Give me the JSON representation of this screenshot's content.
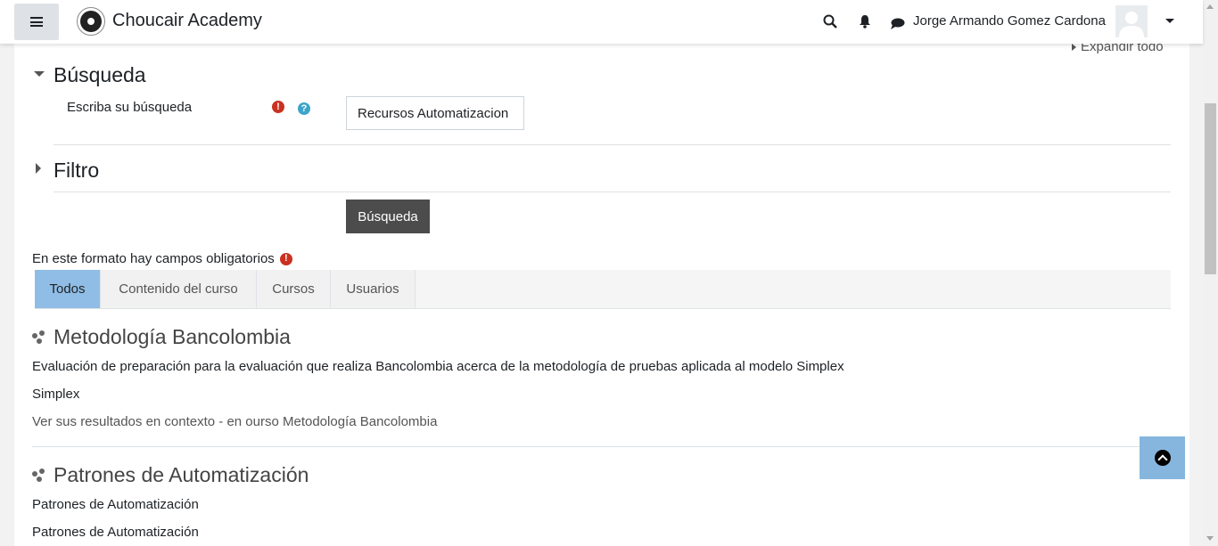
{
  "header": {
    "site_name": "Choucair Academy",
    "user_name": "Jorge Armando Gomez Cardona"
  },
  "form": {
    "expand_all": "Expandir todo",
    "search_section": "Búsqueda",
    "search_label": "Escriba su búsqueda",
    "search_value": "Recursos Automatizacion",
    "filter_section": "Filtro",
    "submit_label": "Búsqueda",
    "required_note": "En este formato hay campos obligatorios"
  },
  "tabs": [
    "Todos",
    "Contenido del curso",
    "Cursos",
    "Usuarios"
  ],
  "results": [
    {
      "title": "Metodología Bancolombia",
      "description": "Evaluación de preparación para la evaluación que realiza Bancolombia acerca de la metodología de pruebas aplicada al modelo Simplex",
      "subtitle": "Simplex",
      "context": "Ver sus resultados en contexto - en ourso Metodología Bancolombia"
    },
    {
      "title": "Patrones de Automatización",
      "description": "Patrones de Automatización",
      "subtitle": "Patrones de Automatización"
    }
  ],
  "colors": {
    "active_tab": "#90bde5",
    "button": "#4c4c4d",
    "error": "#ca3120",
    "help": "#3ea4c8",
    "back_to_top": "#86b6de"
  },
  "icons": [
    "hamburger-icon",
    "search-icon",
    "bell-icon",
    "chat-icon",
    "caret-down-icon",
    "error-icon",
    "help-icon",
    "resource-icon",
    "chevron-up-icon"
  ]
}
